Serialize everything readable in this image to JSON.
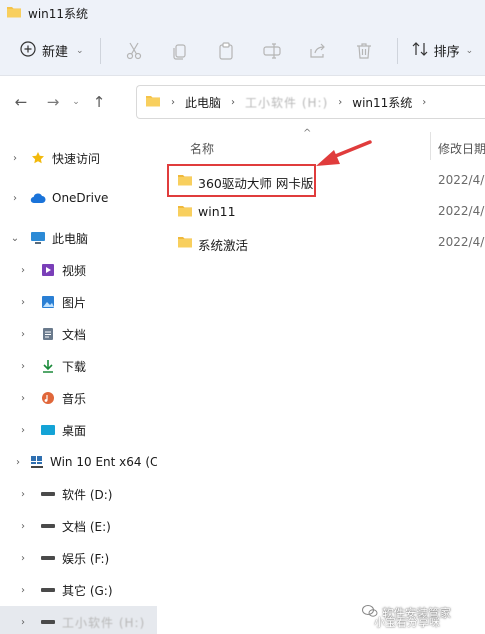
{
  "window": {
    "title": "win11系统"
  },
  "toolbar": {
    "new_label": "新建",
    "sort_label": "排序",
    "icons": [
      "cut-icon",
      "copy-icon",
      "paste-icon",
      "rename-icon",
      "share-icon",
      "delete-icon"
    ]
  },
  "address": {
    "crumbs": [
      "此电脑",
      "工小软件 (H:)",
      "win11系统"
    ]
  },
  "sidebar": {
    "items": [
      {
        "label": "快速访问",
        "icon": "star-icon"
      },
      {
        "label": "OneDrive",
        "icon": "cloud-icon"
      },
      {
        "label": "此电脑",
        "icon": "monitor-icon"
      },
      {
        "label": "视频",
        "icon": "video-icon"
      },
      {
        "label": "图片",
        "icon": "picture-icon"
      },
      {
        "label": "文档",
        "icon": "document-icon"
      },
      {
        "label": "下载",
        "icon": "download-icon"
      },
      {
        "label": "音乐",
        "icon": "music-icon"
      },
      {
        "label": "桌面",
        "icon": "desktop-icon"
      },
      {
        "label": "Win 10 Ent x64 (C",
        "icon": "windows-drive-icon"
      },
      {
        "label": "软件 (D:)",
        "icon": "drive-icon"
      },
      {
        "label": "文档 (E:)",
        "icon": "drive-icon"
      },
      {
        "label": "娱乐 (F:)",
        "icon": "drive-icon"
      },
      {
        "label": "其它 (G:)",
        "icon": "drive-icon"
      },
      {
        "label": "工小软件 (H:)",
        "icon": "drive-icon"
      }
    ]
  },
  "columns": {
    "name": "名称",
    "date": "修改日期"
  },
  "files": [
    {
      "name": "360驱动大师 网卡版",
      "date": "2022/4/2"
    },
    {
      "name": "win11",
      "date": "2022/4/2"
    },
    {
      "name": "系统激活",
      "date": "2022/4/2"
    }
  ],
  "watermark": {
    "text": "软件安装管家",
    "subtext": "小宝看分享咪"
  },
  "colors": {
    "accent": "#e03c3c",
    "folder": "#f5c34a"
  }
}
